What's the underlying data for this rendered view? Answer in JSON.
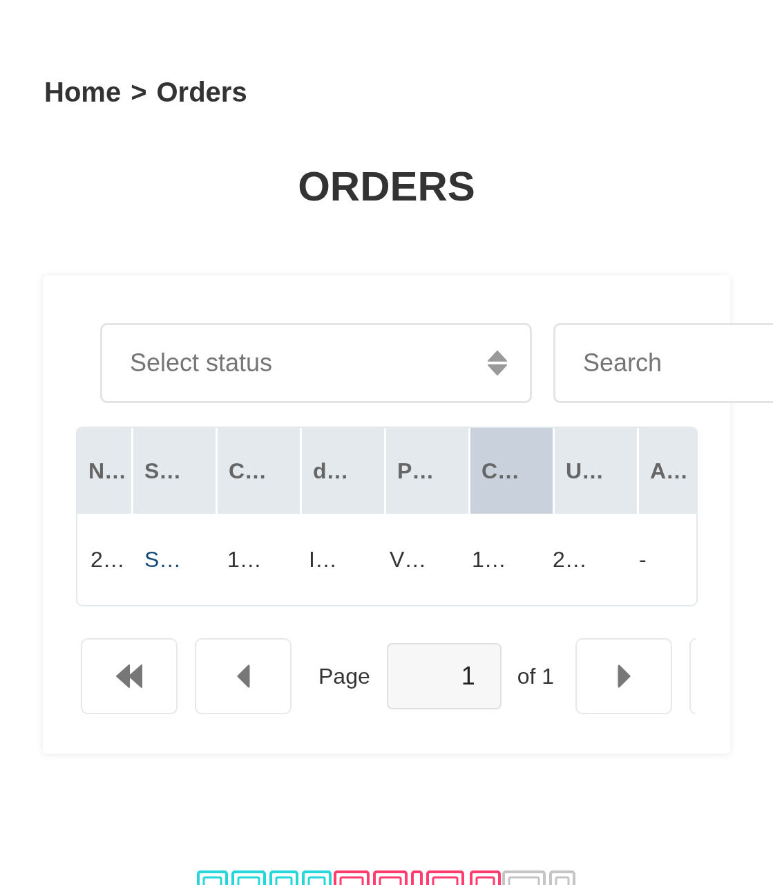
{
  "breadcrumb": {
    "items": [
      {
        "label": "Home"
      },
      {
        "label": "Orders"
      }
    ],
    "separator": ">"
  },
  "title": "ORDERS",
  "filters": {
    "status_select": {
      "placeholder": "Select status"
    },
    "search": {
      "placeholder": "Search"
    }
  },
  "table": {
    "columns": [
      {
        "label": "N…",
        "highlighted": false
      },
      {
        "label": "S…",
        "highlighted": false
      },
      {
        "label": "C…",
        "highlighted": false
      },
      {
        "label": "d…",
        "highlighted": false
      },
      {
        "label": "P…",
        "highlighted": false
      },
      {
        "label": "C…",
        "highlighted": true
      },
      {
        "label": "U…",
        "highlighted": false
      },
      {
        "label": "A…",
        "highlighted": false
      }
    ],
    "rows": [
      {
        "cells": [
          {
            "kind": "text",
            "text": "2…"
          },
          {
            "kind": "link",
            "text": "S…"
          },
          {
            "kind": "text",
            "text": "1…"
          },
          {
            "kind": "text",
            "text": "I…"
          },
          {
            "kind": "text",
            "text": "V…"
          },
          {
            "kind": "text",
            "text": "1…"
          },
          {
            "kind": "text",
            "text": "2…"
          },
          {
            "kind": "text",
            "text": "-"
          }
        ]
      }
    ]
  },
  "pagination": {
    "page_label": "Page",
    "page_input": {
      "value": "1"
    },
    "of_label": "of 1"
  }
}
